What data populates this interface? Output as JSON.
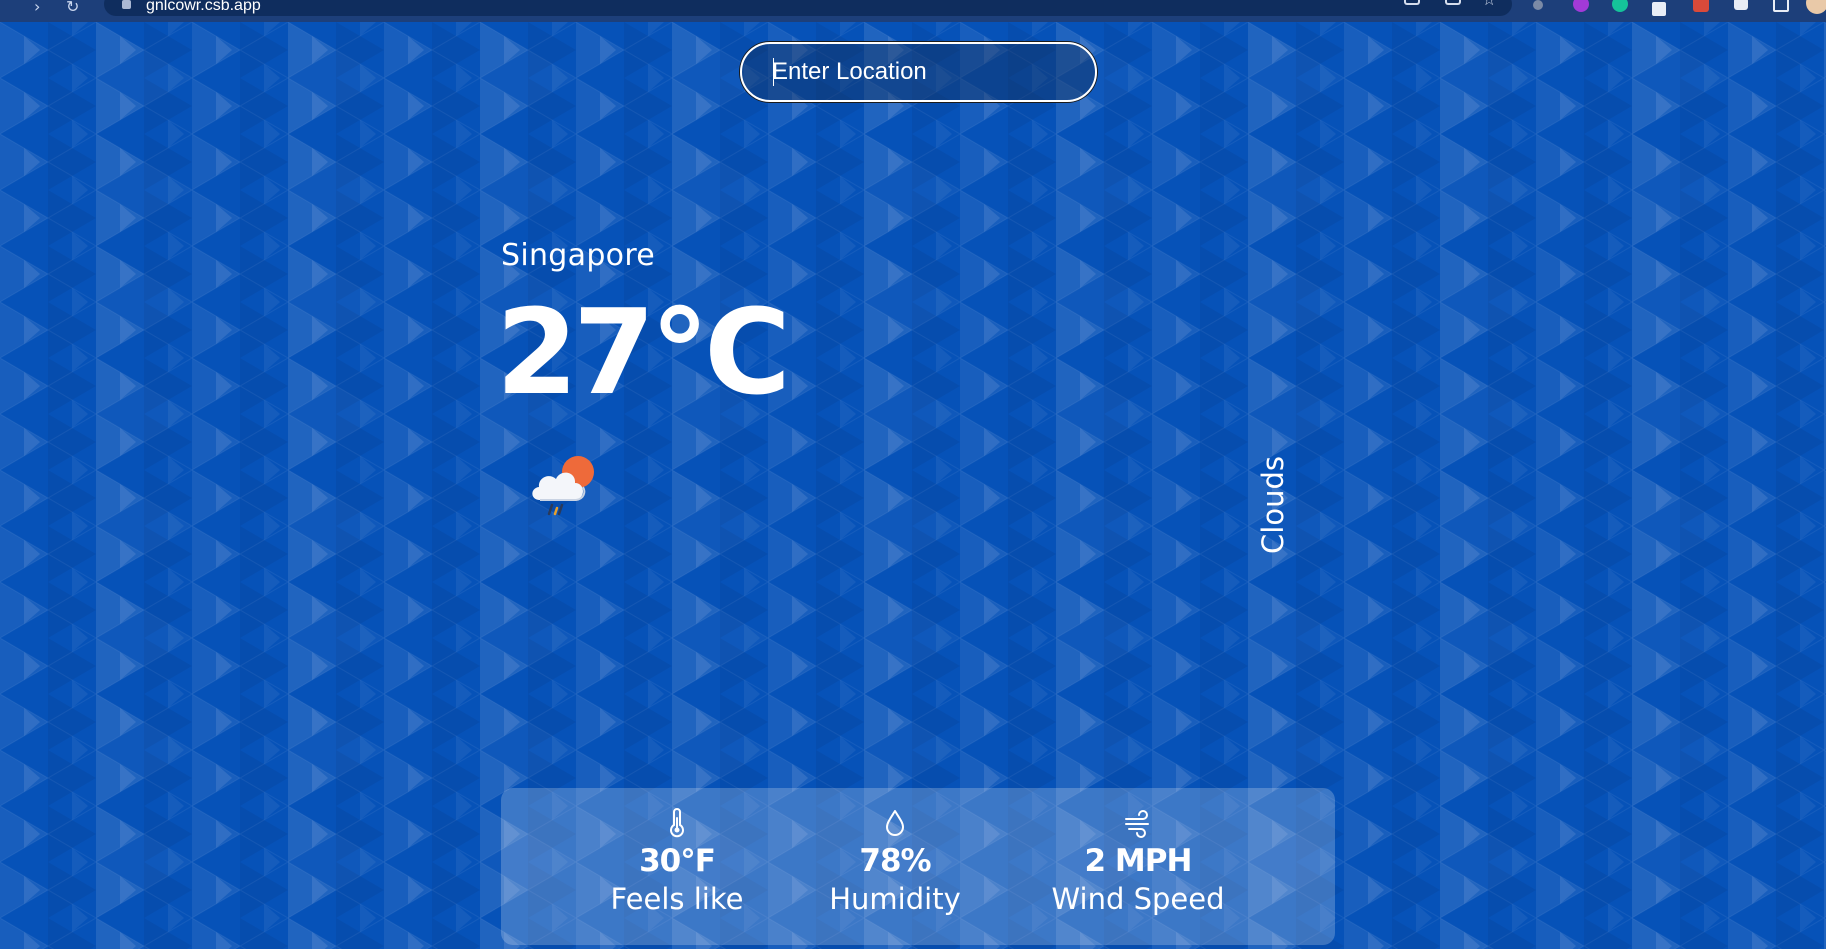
{
  "browser": {
    "url": "gnlcowr.csb.app"
  },
  "search": {
    "placeholder": "Enter Location"
  },
  "weather": {
    "location": "Singapore",
    "temperature": "27°C",
    "description": "Clouds",
    "icon": "cloud-rain-sun-icon"
  },
  "stats": {
    "feels_like": {
      "icon": "thermometer-icon",
      "value": "30°F",
      "label": "Feels like"
    },
    "humidity": {
      "icon": "water-drop-icon",
      "value": "78%",
      "label": "Humidity"
    },
    "wind": {
      "icon": "wind-icon",
      "value": "2 MPH",
      "label": "Wind Speed"
    }
  },
  "colors": {
    "background": "#0652b8",
    "sun": "#ee6a3a",
    "text": "#ffffff"
  }
}
